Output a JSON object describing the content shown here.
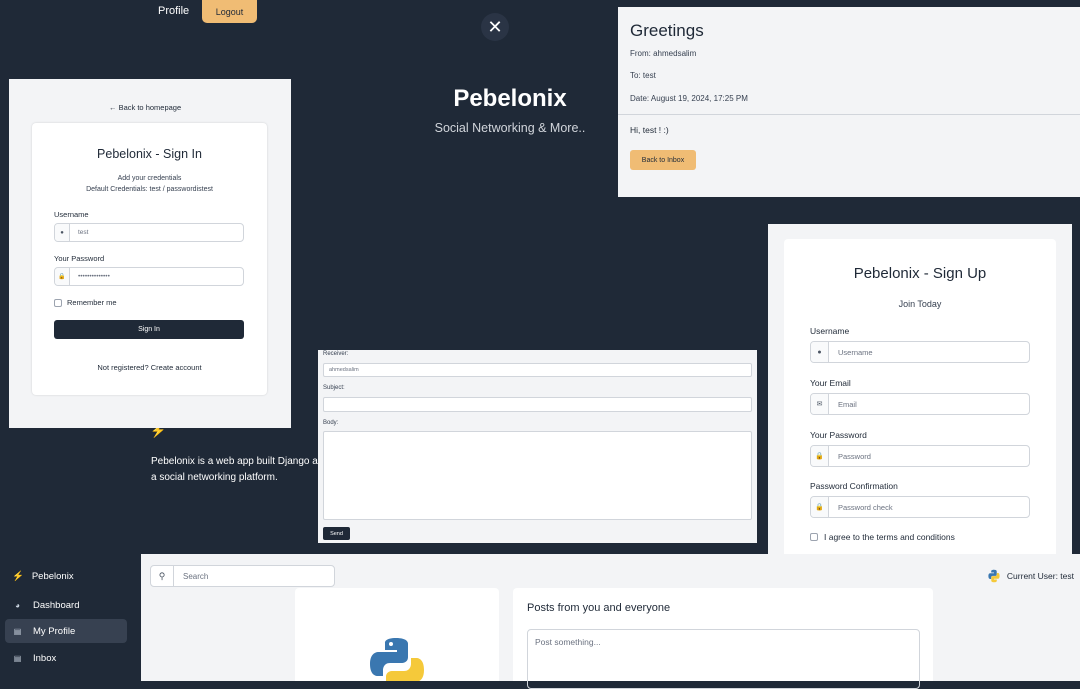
{
  "nav": {
    "profile": "Profile",
    "logout": "Logout"
  },
  "hero": {
    "title": "Pebelonix",
    "subtitle": "Social Networking & More..",
    "about": "Pebelonix is a web app built Django as a social networking platform."
  },
  "signin": {
    "back": "Back to homepage",
    "title": "Pebelonix - Sign In",
    "subtitle": "Add your credentials",
    "default_credentials": "Default Credentials: test / passwordistest",
    "username_label": "Username",
    "username_value": "test",
    "password_label": "Your Password",
    "password_value": "••••••••••••••",
    "remember": "Remember me",
    "button": "Sign In",
    "register": "Not registered? Create account"
  },
  "greetings": {
    "title": "Greetings",
    "from": "From: ahmedsalim",
    "to": "To: test",
    "date": "Date: August 19, 2024, 17:25 PM",
    "message": "Hi, test ! :)",
    "back_button": "Back to Inbox"
  },
  "compose": {
    "receiver_label": "Receiver:",
    "receiver_value": "ahmedsalim",
    "subject_label": "Subject:",
    "body_label": "Body:",
    "send": "Send"
  },
  "signup": {
    "title": "Pebelonix - Sign Up",
    "subtitle": "Join Today",
    "username_label": "Username",
    "username_placeholder": "Username",
    "email_label": "Your Email",
    "email_placeholder": "Email",
    "password_label": "Your Password",
    "password_placeholder": "Password",
    "confirm_label": "Password Confirmation",
    "confirm_placeholder": "Password check",
    "agree": "I agree to the terms and conditions"
  },
  "dashboard": {
    "brand": "Pebelonix",
    "items": [
      {
        "label": "Dashboard"
      },
      {
        "label": "My Profile"
      },
      {
        "label": "Inbox"
      }
    ],
    "search_placeholder": "Search",
    "current_user": "Current User: test",
    "posts_title": "Posts from you and everyone",
    "post_placeholder": "Post something..."
  },
  "colors": {
    "background": "#1f2937",
    "accent": "#f0bc74",
    "panel": "#f3f4f6"
  }
}
